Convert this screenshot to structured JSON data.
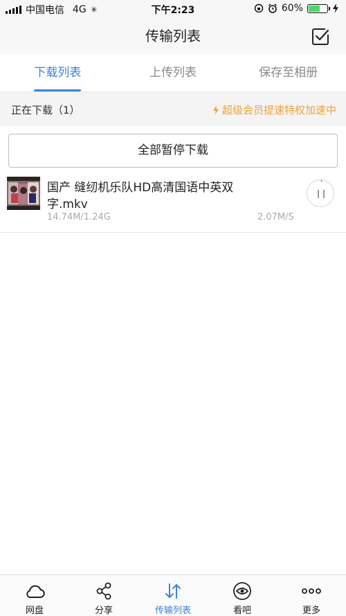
{
  "status_bar": {
    "carrier": "中国电信",
    "network": "4G",
    "time": "下午2:23",
    "battery": "60%",
    "battery_level": 0.6
  },
  "nav": {
    "title": "传输列表"
  },
  "tabs": [
    {
      "label": "下载列表",
      "active": true
    },
    {
      "label": "上传列表",
      "active": false
    },
    {
      "label": "保存至相册",
      "active": false
    }
  ],
  "section": {
    "downloading": "正在下载（1）",
    "vip_promo": "超级会员提速特权加速中"
  },
  "actions": {
    "pause_all": "全部暂停下载"
  },
  "downloads": [
    {
      "name": "国产 缝纫机乐队HD高清国语中英双字.mkv",
      "size": "14.74M/1.24G",
      "speed": "2.07M/S",
      "progress": 0.012
    }
  ],
  "bottom_tabs": [
    {
      "label": "网盘",
      "icon": "cloud-icon"
    },
    {
      "label": "分享",
      "icon": "share-icon"
    },
    {
      "label": "传输列表",
      "icon": "transfer-icon",
      "active": true
    },
    {
      "label": "看吧",
      "icon": "eye-icon"
    },
    {
      "label": "更多",
      "icon": "more-icon"
    }
  ],
  "colors": {
    "accent": "#3b82d6",
    "vip": "#f0a33a",
    "battery": "#4cd964"
  }
}
